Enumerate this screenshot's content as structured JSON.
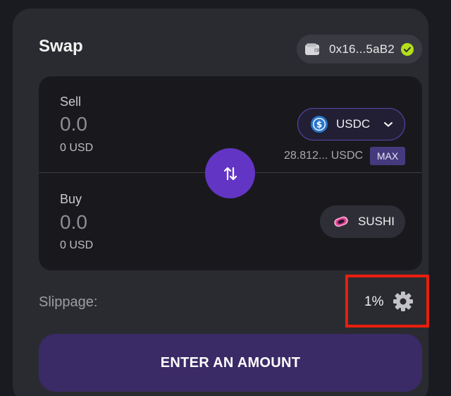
{
  "header": {
    "title": "Swap"
  },
  "wallet": {
    "address": "0x16...5aB2",
    "icon": "wallet-icon",
    "status_icon": "check-icon"
  },
  "sell": {
    "label": "Sell",
    "amount": "0.0",
    "usd": "0 USD",
    "token": {
      "symbol": "USDC",
      "icon": "usdc-icon"
    },
    "balance": "28.812... USDC",
    "max_label": "MAX"
  },
  "buy": {
    "label": "Buy",
    "amount": "0.0",
    "usd": "0 USD",
    "token": {
      "symbol": "SUSHI",
      "icon": "sushi-icon"
    }
  },
  "slippage": {
    "label": "Slippage:",
    "value": "1%"
  },
  "action": {
    "label": "ENTER AN AMOUNT"
  },
  "colors": {
    "accent": "#6335c4",
    "cta_background": "#3a2a66",
    "highlight_border": "#e81e0c",
    "verified": "#b5e01a"
  }
}
